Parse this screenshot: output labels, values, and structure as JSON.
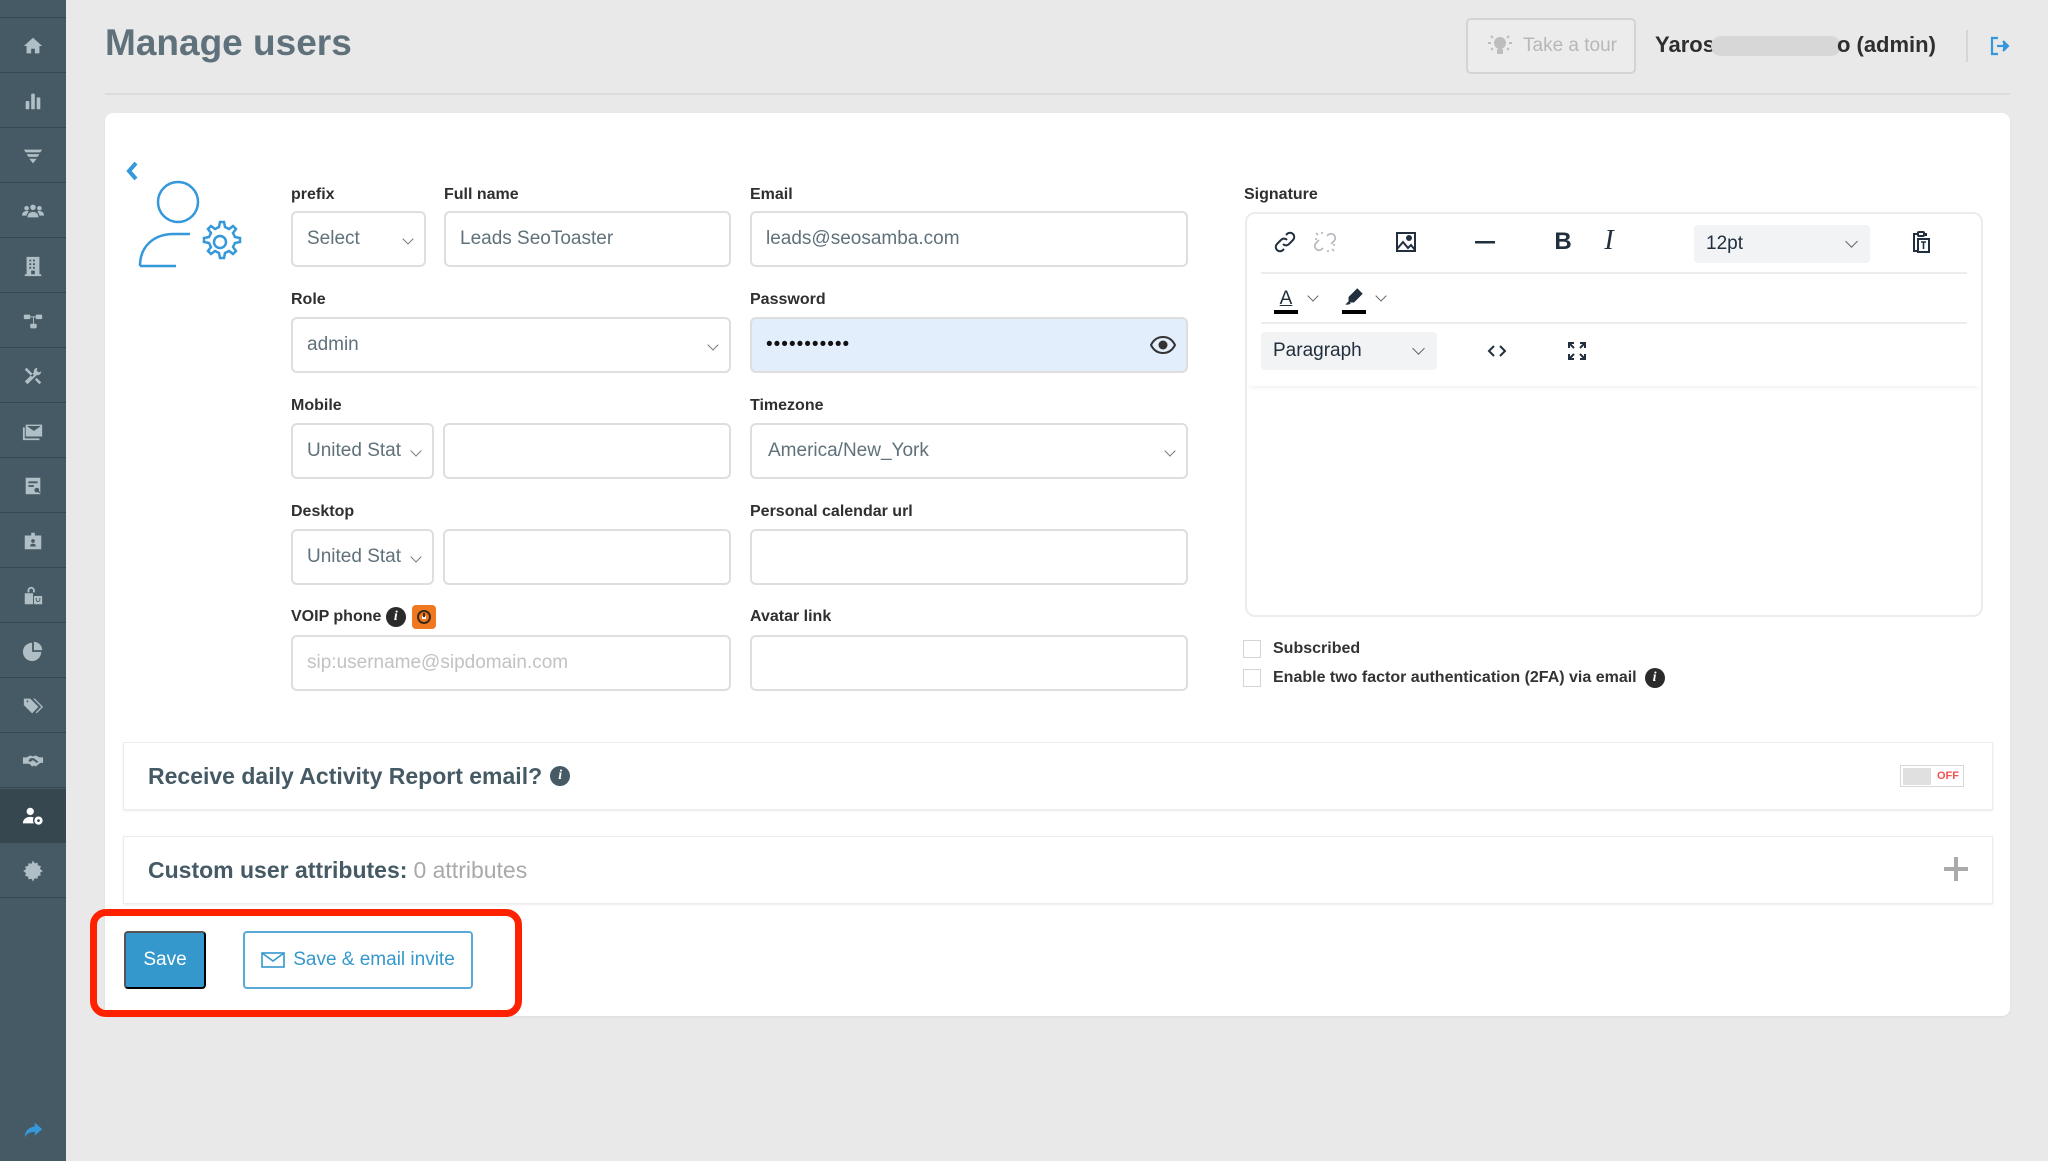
{
  "sidebar": {
    "items": [
      {
        "name": "home",
        "icon": "home-icon"
      },
      {
        "name": "analytics",
        "icon": "bar-chart-icon"
      },
      {
        "name": "funnel",
        "icon": "funnel-icon"
      },
      {
        "name": "contacts",
        "icon": "users-icon"
      },
      {
        "name": "companies",
        "icon": "building-icon"
      },
      {
        "name": "automation",
        "icon": "sitemap-icon"
      },
      {
        "name": "tools",
        "icon": "tools-icon"
      },
      {
        "name": "email",
        "icon": "envelope-icon"
      },
      {
        "name": "reports",
        "icon": "report-search-icon"
      },
      {
        "name": "id-card",
        "icon": "id-badge-icon"
      },
      {
        "name": "shop",
        "icon": "shopping-icon"
      },
      {
        "name": "pie",
        "icon": "pie-chart-icon"
      },
      {
        "name": "tags",
        "icon": "tags-icon"
      },
      {
        "name": "deals",
        "icon": "handshake-icon"
      },
      {
        "name": "manage-users",
        "icon": "user-gear-icon",
        "active": true
      },
      {
        "name": "settings",
        "icon": "gear-icon"
      }
    ],
    "bottom_icon": "share-arrow-icon"
  },
  "header": {
    "title": "Manage users",
    "tour_label": "Take a tour",
    "user_name_start": "Yaros",
    "user_name_end": "o (admin)"
  },
  "form": {
    "prefix": {
      "label": "prefix",
      "value": "Select"
    },
    "full_name": {
      "label": "Full name",
      "value": "Leads SeoToaster"
    },
    "email": {
      "label": "Email",
      "value": "leads@seosamba.com"
    },
    "role": {
      "label": "Role",
      "value": "admin"
    },
    "password": {
      "label": "Password",
      "value": "•••••••••••"
    },
    "mobile": {
      "label": "Mobile",
      "country": "United Stat",
      "value": ""
    },
    "timezone": {
      "label": "Timezone",
      "value": "America/New_York"
    },
    "desktop": {
      "label": "Desktop",
      "country": "United Stat",
      "value": ""
    },
    "calendar_url": {
      "label": "Personal calendar url",
      "value": ""
    },
    "voip": {
      "label": "VOIP phone",
      "placeholder": "sip:username@sipdomain.com",
      "value": ""
    },
    "avatar_link": {
      "label": "Avatar link",
      "value": ""
    }
  },
  "signature": {
    "label": "Signature",
    "font_size": "12pt",
    "block_format": "Paragraph",
    "content": ""
  },
  "checkboxes": {
    "subscribed": {
      "label": "Subscribed",
      "checked": false
    },
    "two_fa": {
      "label": "Enable two factor authentication (2FA) via email",
      "checked": false
    }
  },
  "activity_report": {
    "label": "Receive daily Activity Report email?",
    "toggle_state": "OFF"
  },
  "custom_attributes": {
    "label": "Custom user attributes:",
    "count_text": "0 attributes"
  },
  "actions": {
    "save_label": "Save",
    "invite_label": "Save & email invite"
  },
  "colors": {
    "accent": "#3498cd",
    "sidebar_bg": "#455a64",
    "highlight": "#ff2200",
    "toggle_off": "#ef5350"
  }
}
